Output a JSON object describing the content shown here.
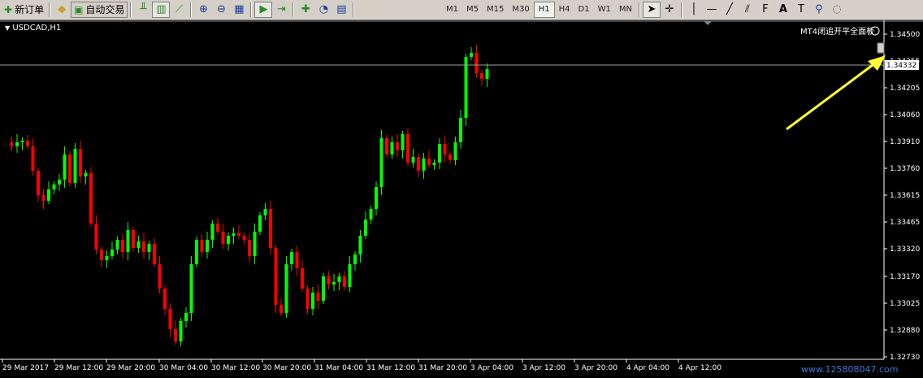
{
  "toolbar": {
    "new_order": "新订单",
    "auto_trading": "自动交易",
    "timeframes": [
      "M1",
      "M5",
      "M15",
      "M30",
      "H1",
      "H4",
      "D1",
      "W1",
      "MN"
    ],
    "active_timeframe": "H1"
  },
  "chart": {
    "symbol": "USDCAD,H1",
    "panel_label": "MT4闭追开平全面板",
    "current_price": "1.34332",
    "price_levels": [
      "1.34500",
      "1.34355",
      "1.34205",
      "1.34060",
      "1.33910",
      "1.33760",
      "1.33615",
      "1.33465",
      "1.33320",
      "1.33170",
      "1.33025",
      "1.32880",
      "1.32730"
    ],
    "time_labels": [
      "29 Mar 2017",
      "29 Mar 12:00",
      "29 Mar 20:00",
      "30 Mar 04:00",
      "30 Mar 12:00",
      "30 Mar 20:00",
      "31 Mar 04:00",
      "31 Mar 12:00",
      "31 Mar 20:00",
      "3 Apr 04:00",
      "3 Apr 12:00",
      "3 Apr 20:00",
      "4 Apr 04:00",
      "4 Apr 12:00"
    ],
    "bull_color": "#00ff00",
    "bear_color": "#ff0000",
    "arrow_color": "#ffff33"
  },
  "watermark": "www.125808047.com"
}
